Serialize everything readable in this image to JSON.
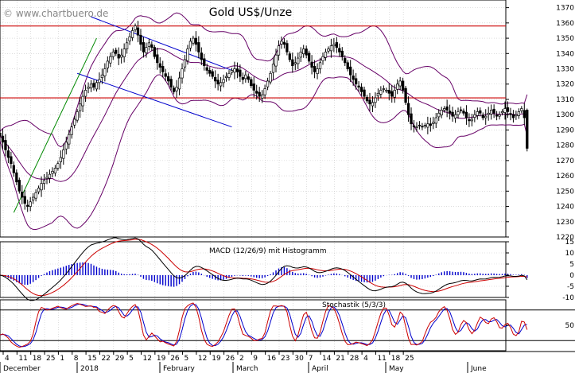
{
  "watermark": "© www.chartbuero.de",
  "colors": {
    "candle": "#000000",
    "bollinger": "#660066",
    "resistance": "#cc0000",
    "channel": "#0000cc",
    "uptrend": "#008800",
    "macd_line": "#000000",
    "macd_signal": "#cc0000",
    "macd_hist": "#0000cc",
    "stoch_k": "#cc0000",
    "stoch_d": "#0000cc",
    "grid": "#c8c8c8",
    "frame": "#000000"
  },
  "chart_data": [
    {
      "type": "candlestick",
      "title": "Gold US$/Unze",
      "ylim": [
        1220,
        1375
      ],
      "y_ticks": [
        1220,
        1230,
        1240,
        1250,
        1260,
        1270,
        1280,
        1290,
        1300,
        1310,
        1320,
        1330,
        1340,
        1350,
        1360,
        1370
      ],
      "grid": true,
      "x_day_labels": [
        "4",
        "11",
        "18",
        "25",
        "1",
        "8",
        "15",
        "22",
        "29",
        "5",
        "12",
        "19",
        "26",
        "5",
        "12",
        "19",
        "26",
        "2",
        "9",
        "16",
        "23",
        "30",
        "7",
        "14",
        "21",
        "28",
        "4",
        "11",
        "18",
        "25"
      ],
      "x_month_labels": [
        "December",
        "2018",
        "February",
        "March",
        "April",
        "May",
        "June"
      ],
      "bars_per_week": 5,
      "closes": [
        1286,
        1282,
        1277,
        1272,
        1268,
        1262,
        1256,
        1250,
        1246,
        1242,
        1240,
        1243,
        1246,
        1249,
        1252,
        1255,
        1257,
        1259,
        1261,
        1263,
        1265,
        1268,
        1272,
        1277,
        1282,
        1287,
        1292,
        1297,
        1302,
        1307,
        1312,
        1316,
        1318,
        1320,
        1318,
        1321,
        1323,
        1326,
        1330,
        1335,
        1338,
        1341,
        1340,
        1337,
        1339,
        1343,
        1347,
        1351,
        1355,
        1358,
        1352,
        1346,
        1341,
        1344,
        1347,
        1344,
        1338,
        1334,
        1331,
        1328,
        1325,
        1322,
        1318,
        1315,
        1318,
        1324,
        1330,
        1336,
        1343,
        1348,
        1350,
        1346,
        1341,
        1336,
        1332,
        1329,
        1327,
        1325,
        1322,
        1320,
        1321,
        1323,
        1325,
        1327,
        1329,
        1330,
        1328,
        1325,
        1323,
        1326,
        1323,
        1319,
        1316,
        1314,
        1312,
        1313,
        1317,
        1322,
        1327,
        1333,
        1339,
        1345,
        1348,
        1346,
        1341,
        1336,
        1332,
        1334,
        1337,
        1341,
        1343,
        1339,
        1335,
        1331,
        1328,
        1330,
        1334,
        1338,
        1341,
        1343,
        1345,
        1346,
        1344,
        1341,
        1338,
        1334,
        1330,
        1326,
        1323,
        1320,
        1318,
        1315,
        1312,
        1309,
        1307,
        1308,
        1311,
        1314,
        1316,
        1317,
        1316,
        1314,
        1312,
        1316,
        1320,
        1322,
        1316,
        1308,
        1300,
        1294,
        1292,
        1292,
        1293,
        1292,
        1293,
        1294,
        1293,
        1295,
        1298,
        1301,
        1303,
        1304,
        1303,
        1301,
        1299,
        1300,
        1302,
        1303,
        1301,
        1298,
        1296,
        1297,
        1300,
        1302,
        1301,
        1298,
        1299,
        1301,
        1303,
        1301,
        1299,
        1300,
        1302,
        1304,
        1302,
        1300,
        1298,
        1300,
        1302,
        1304,
        1298,
        1278
      ],
      "bollinger_bands": true,
      "resistance_levels": [
        1358,
        1311
      ],
      "down_channel": [
        {
          "from": [
            "Jan 22",
            1364
          ],
          "to": [
            "Apr 2",
            1329
          ]
        },
        {
          "from": [
            "Jan 15",
            1327
          ],
          "to": [
            "Apr 2",
            1292
          ]
        }
      ],
      "uptrend_line": {
        "from": [
          "Dec 11",
          1236
        ],
        "to": [
          "Jan 25",
          1350
        ]
      }
    },
    {
      "type": "line",
      "title": "MACD (12/26/9) mit Histogramm",
      "ylim": [
        -10,
        15
      ],
      "y_ticks": [
        -10,
        -5,
        0,
        5,
        10,
        15
      ],
      "series": [
        "macd",
        "signal",
        "histogram"
      ]
    },
    {
      "type": "line",
      "title": "Stochastik (5/3/3)",
      "ylim": [
        0,
        100
      ],
      "y_ticks": [
        50
      ],
      "levels": [
        80,
        20
      ],
      "series": [
        "%K",
        "%D"
      ]
    }
  ]
}
